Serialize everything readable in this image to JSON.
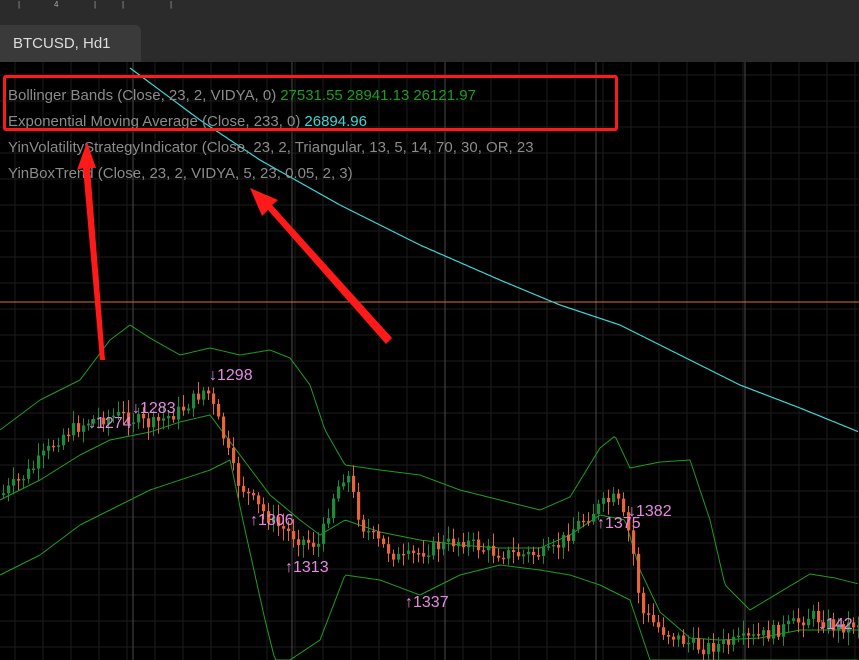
{
  "ruler": {
    "tick_label": "4"
  },
  "tab": {
    "label": "BTCUSD, Hd1"
  },
  "legend": {
    "bb_label": "Bollinger Bands (Close, 23, 2, VIDYA, 0)",
    "bb_values": [
      "27531.55",
      "28941.13",
      "26121.97"
    ],
    "ema_label": "Exponential Moving Average (Close, 233, 0)",
    "ema_value": "26894.96",
    "yinvol_label": "YinVolatilityStrategyIndicator (Close, 23, 2, Triangular, 13, 5, 14, 70, 30, OR, 23",
    "yinbox_label": "YinBoxTrend (Close, 23, 2, VIDYA, 5, 23, 0.05, 2, 3)"
  },
  "signals": [
    {
      "text": "↓1274",
      "dir": "down"
    },
    {
      "text": "↓1283",
      "dir": "down"
    },
    {
      "text": "↓1298",
      "dir": "down"
    },
    {
      "text": "↑1306",
      "dir": "up"
    },
    {
      "text": "↑1313",
      "dir": "up"
    },
    {
      "text": "↑1337",
      "dir": "up"
    },
    {
      "text": "↑1375",
      "dir": "up"
    },
    {
      "text": "↓1382",
      "dir": "down"
    },
    {
      "text": "↓142",
      "dir": "down"
    }
  ],
  "colors": {
    "background": "#000000",
    "bull_candle": "#1e8a3c",
    "bear_candle": "#e8643a",
    "bands": "#1f9d1f",
    "ema": "#3fd6d6",
    "signal": "#e58ae0",
    "crosshair": "#d9703a",
    "highlight": "#ff1a1a"
  }
}
